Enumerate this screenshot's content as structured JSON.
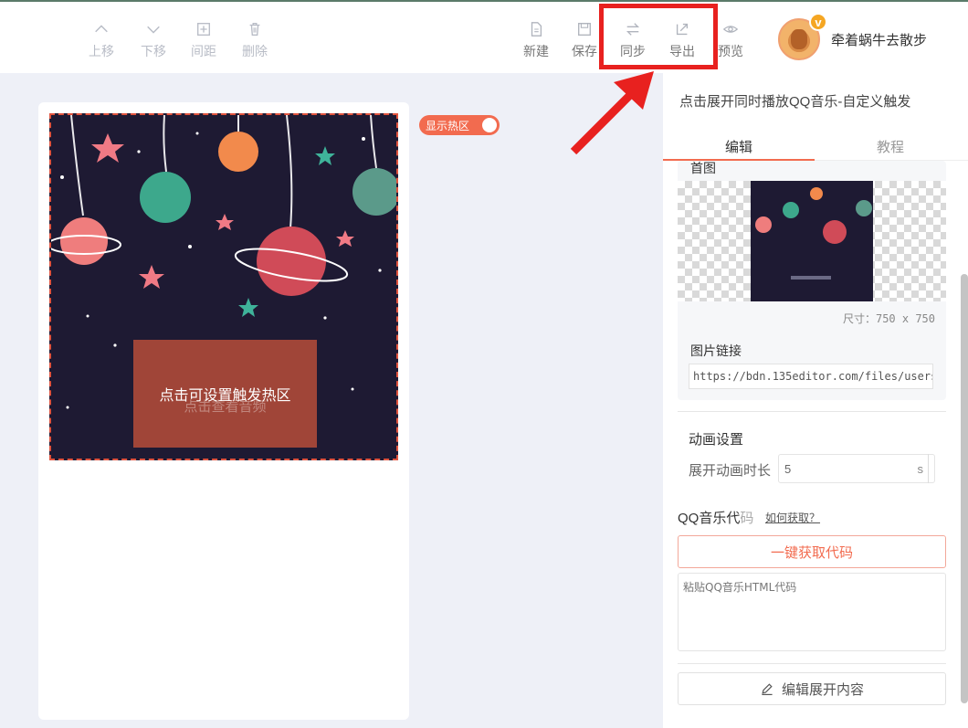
{
  "toolbar": {
    "up": "上移",
    "down": "下移",
    "spacing": "间距",
    "delete": "删除",
    "new": "新建",
    "save": "保存",
    "sync": "同步",
    "export": "导出",
    "preview": "预览"
  },
  "user": {
    "name": "牵着蜗牛去散步",
    "badge": "v"
  },
  "canvas": {
    "hot_zone_toggle_label": "显示热区",
    "hot_zone_text": "点击可设置触发热区",
    "hot_zone_ghost_text": "点击查看音频"
  },
  "panel": {
    "title": "点击展开同时播放QQ音乐-自定义触发",
    "tabs": [
      {
        "label": "编辑"
      },
      {
        "label": "教程"
      }
    ],
    "image_caption": "首图",
    "image_size": "尺寸：750 x 750",
    "link_label": "图片链接",
    "link_value": "https://bdn.135editor.com/files/users/0/",
    "animation_section": "动画设置",
    "duration_label": "展开动画时长",
    "duration_value": "5",
    "duration_unit": "s",
    "qq_label_dark": "QQ音乐代",
    "qq_label_light": "码",
    "how_to": "如何获取？",
    "get_code_button": "一键获取代码",
    "code_placeholder": "粘贴QQ音乐HTML代码",
    "edit_button": "编辑展开内容"
  },
  "colors": {
    "accent": "#f26b4f",
    "highlight": "#e8211f",
    "art_bg": "#1e1a33"
  }
}
